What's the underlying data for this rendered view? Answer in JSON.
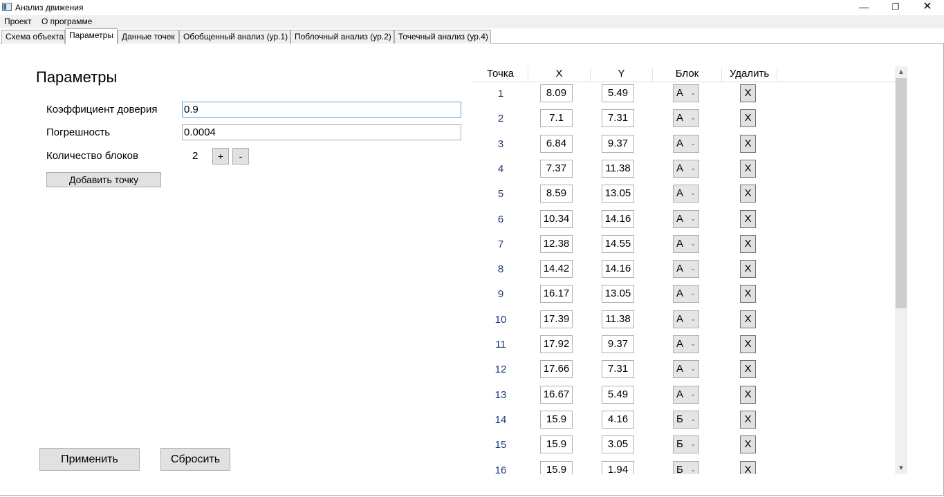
{
  "window": {
    "title": "Анализ движения",
    "minimize": "—",
    "maximize": "❐",
    "close": "✕"
  },
  "menu": [
    "Проект",
    "О программе"
  ],
  "tabs": [
    "Схема объекта",
    "Параметры",
    "Данные точек",
    "Обобщенный анализ (ур.1)",
    "Поблочный анализ (ур.2)",
    "Точечный анализ (ур.4)"
  ],
  "active_tab": "Параметры",
  "params": {
    "title": "Параметры",
    "confidence_label": "Коэффициент доверия",
    "confidence_value": "0.9",
    "error_label": "Погрешность",
    "error_value": "0.0004",
    "blocks_label": "Количество блоков",
    "blocks_value": "2",
    "plus": "+",
    "minus": "-",
    "add_point": "Добавить точку",
    "apply": "Применить",
    "reset": "Сбросить"
  },
  "table": {
    "headers": [
      "Точка",
      "X",
      "Y",
      "Блок",
      "Удалить"
    ],
    "delete_label": "X",
    "rows": [
      {
        "n": "1",
        "x": "8.09",
        "y": "5.49",
        "block": "А"
      },
      {
        "n": "2",
        "x": "7.1",
        "y": "7.31",
        "block": "А"
      },
      {
        "n": "3",
        "x": "6.84",
        "y": "9.37",
        "block": "А"
      },
      {
        "n": "4",
        "x": "7.37",
        "y": "11.38",
        "block": "А"
      },
      {
        "n": "5",
        "x": "8.59",
        "y": "13.05",
        "block": "А"
      },
      {
        "n": "6",
        "x": "10.34",
        "y": "14.16",
        "block": "А"
      },
      {
        "n": "7",
        "x": "12.38",
        "y": "14.55",
        "block": "А"
      },
      {
        "n": "8",
        "x": "14.42",
        "y": "14.16",
        "block": "А"
      },
      {
        "n": "9",
        "x": "16.17",
        "y": "13.05",
        "block": "А"
      },
      {
        "n": "10",
        "x": "17.39",
        "y": "11.38",
        "block": "А"
      },
      {
        "n": "11",
        "x": "17.92",
        "y": "9.37",
        "block": "А"
      },
      {
        "n": "12",
        "x": "17.66",
        "y": "7.31",
        "block": "А"
      },
      {
        "n": "13",
        "x": "16.67",
        "y": "5.49",
        "block": "А"
      },
      {
        "n": "14",
        "x": "15.9",
        "y": "4.16",
        "block": "Б"
      },
      {
        "n": "15",
        "x": "15.9",
        "y": "3.05",
        "block": "Б"
      },
      {
        "n": "16",
        "x": "15.9",
        "y": "1.94",
        "block": "Б"
      }
    ]
  },
  "scrollbar": {
    "up": "▲",
    "down": "▼"
  }
}
